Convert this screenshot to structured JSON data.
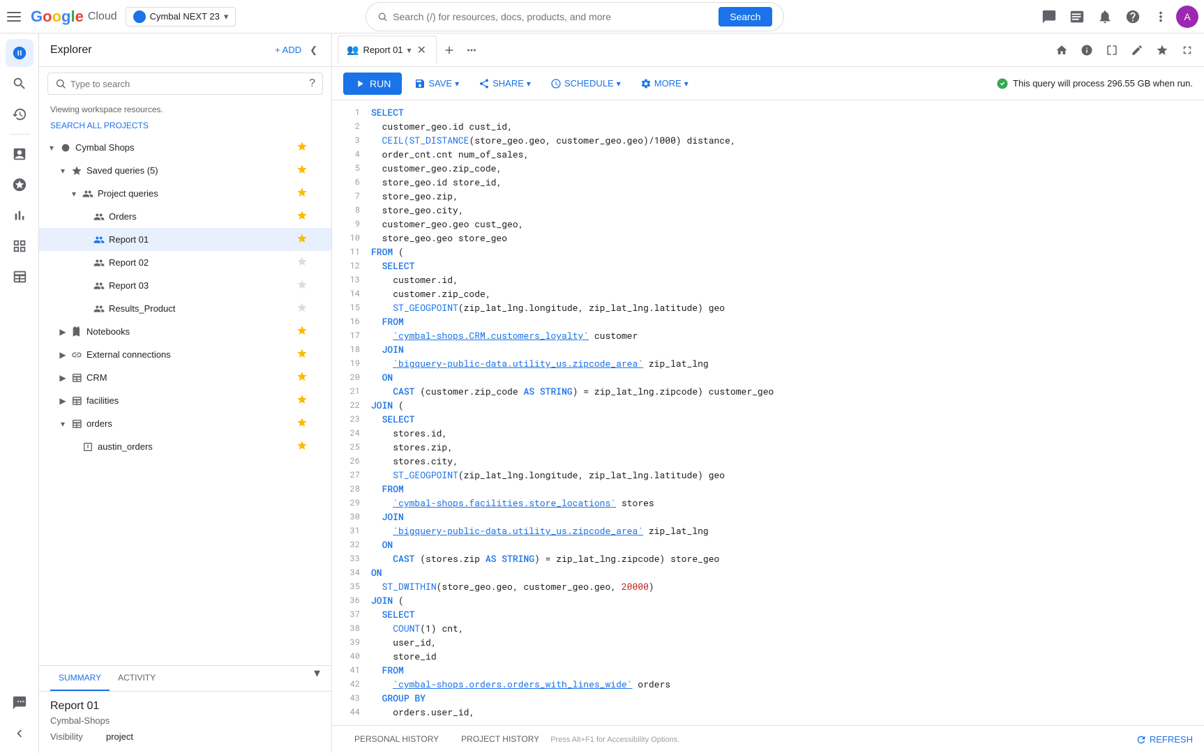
{
  "navbar": {
    "hamburger_label": "menu",
    "logo_text": "Google Cloud",
    "project_selector": {
      "icon": "●",
      "name": "Cymbal NEXT 23",
      "chevron": "▾"
    },
    "search": {
      "placeholder": "Search (/) for resources, docs, products, and more",
      "button_label": "Search"
    },
    "icons": [
      {
        "name": "support-chat-icon",
        "glyph": "💬"
      },
      {
        "name": "terminal-icon",
        "glyph": "⌨"
      },
      {
        "name": "notifications-icon",
        "glyph": "🔔"
      },
      {
        "name": "help-icon",
        "glyph": "?"
      },
      {
        "name": "more-icon",
        "glyph": "⋮"
      }
    ],
    "avatar": "A"
  },
  "explorer": {
    "title": "Explorer",
    "add_label": "+ ADD",
    "collapse_label": "❮",
    "search_placeholder": "Type to search",
    "workspace_info": "Viewing workspace resources.",
    "search_all_label": "SEARCH ALL PROJECTS",
    "tree": [
      {
        "id": "cymbal-shops",
        "level": 0,
        "toggle": "▾",
        "icon": "●",
        "icon_color": "#5f6368",
        "label": "Cymbal Shops",
        "starred": true,
        "has_more": true
      },
      {
        "id": "saved-queries",
        "level": 1,
        "toggle": "▾",
        "icon": "★",
        "icon_color": "#5f6368",
        "label": "Saved queries (5)",
        "starred": true,
        "has_more": true
      },
      {
        "id": "project-queries",
        "level": 2,
        "toggle": "▾",
        "icon": "👥",
        "icon_color": "#5f6368",
        "label": "Project queries",
        "starred": true,
        "has_more": true
      },
      {
        "id": "orders",
        "level": 3,
        "toggle": "",
        "icon": "👥",
        "icon_color": "#5f6368",
        "label": "Orders",
        "starred": true,
        "has_more": true
      },
      {
        "id": "report-01",
        "level": 3,
        "toggle": "",
        "icon": "👥",
        "icon_color": "#1a73e8",
        "label": "Report 01",
        "starred": true,
        "has_more": true,
        "selected": true
      },
      {
        "id": "report-02",
        "level": 3,
        "toggle": "",
        "icon": "👥",
        "icon_color": "#5f6368",
        "label": "Report 02",
        "starred": false,
        "has_more": true
      },
      {
        "id": "report-03",
        "level": 3,
        "toggle": "",
        "icon": "👥",
        "icon_color": "#5f6368",
        "label": "Report 03",
        "starred": false,
        "has_more": true
      },
      {
        "id": "results-product",
        "level": 3,
        "toggle": "",
        "icon": "👥",
        "icon_color": "#5f6368",
        "label": "Results_Product",
        "starred": false,
        "has_more": true
      },
      {
        "id": "notebooks",
        "level": 1,
        "toggle": "▶",
        "icon": "📓",
        "icon_color": "#5f6368",
        "label": "Notebooks",
        "starred": true,
        "has_more": true
      },
      {
        "id": "external-connections",
        "level": 1,
        "toggle": "▶",
        "icon": "🔗",
        "icon_color": "#5f6368",
        "label": "External connections",
        "starred": true,
        "has_more": true
      },
      {
        "id": "crm",
        "level": 1,
        "toggle": "▶",
        "icon": "⊞",
        "icon_color": "#5f6368",
        "label": "CRM",
        "starred": true,
        "has_more": true
      },
      {
        "id": "facilities",
        "level": 1,
        "toggle": "▶",
        "icon": "⊞",
        "icon_color": "#5f6368",
        "label": "facilities",
        "starred": true,
        "has_more": true
      },
      {
        "id": "orders-db",
        "level": 1,
        "toggle": "▾",
        "icon": "⊞",
        "icon_color": "#5f6368",
        "label": "orders",
        "starred": true,
        "has_more": true
      },
      {
        "id": "austin-orders",
        "level": 2,
        "toggle": "",
        "icon": "⊟",
        "icon_color": "#5f6368",
        "label": "austin_orders",
        "starred": true,
        "has_more": true
      }
    ]
  },
  "info_panel": {
    "tabs": [
      {
        "id": "summary",
        "label": "SUMMARY",
        "active": true
      },
      {
        "id": "activity",
        "label": "ACTIVITY",
        "active": false
      }
    ],
    "title": "Report 01",
    "subtitle": "Cymbal-Shops",
    "fields": [
      {
        "key": "Visibility",
        "value": "project"
      }
    ],
    "chevron": "▾"
  },
  "tabs": [
    {
      "id": "report-01",
      "icon": "👥",
      "label": "Report 01",
      "active": true,
      "closeable": true
    }
  ],
  "toolbar": {
    "run_label": "RUN",
    "run_icon": "▶",
    "save_label": "SAVE",
    "save_icon": "💾",
    "share_label": "SHARE",
    "share_icon": "🔗",
    "schedule_label": "SCHEDULE",
    "schedule_icon": "⏱",
    "more_label": "MORE",
    "more_icon": "⚙",
    "status_text": "This query will process 296.55 GB when run.",
    "status_icon": "✓"
  },
  "editor": {
    "lines": [
      {
        "num": 1,
        "tokens": [
          {
            "type": "kw",
            "text": "SELECT"
          }
        ]
      },
      {
        "num": 2,
        "tokens": [
          {
            "type": "plain",
            "text": "  customer_geo.id cust_id,"
          }
        ]
      },
      {
        "num": 3,
        "tokens": [
          {
            "type": "plain",
            "text": "  "
          },
          {
            "type": "fn",
            "text": "CEIL(ST_DISTANCE"
          },
          {
            "type": "plain",
            "text": "(store_geo.geo, customer_geo.geo)"
          },
          {
            "type": "plain",
            "text": "/1000) distance,"
          }
        ]
      },
      {
        "num": 4,
        "tokens": [
          {
            "type": "plain",
            "text": "  order_cnt.cnt num_of_sales,"
          }
        ]
      },
      {
        "num": 5,
        "tokens": [
          {
            "type": "plain",
            "text": "  customer_geo.zip_code,"
          }
        ]
      },
      {
        "num": 6,
        "tokens": [
          {
            "type": "plain",
            "text": "  store_geo.id store_id,"
          }
        ]
      },
      {
        "num": 7,
        "tokens": [
          {
            "type": "plain",
            "text": "  store_geo.zip,"
          }
        ]
      },
      {
        "num": 8,
        "tokens": [
          {
            "type": "plain",
            "text": "  store_geo.city,"
          }
        ]
      },
      {
        "num": 9,
        "tokens": [
          {
            "type": "plain",
            "text": "  customer_geo.geo cust_geo,"
          }
        ]
      },
      {
        "num": 10,
        "tokens": [
          {
            "type": "plain",
            "text": "  store_geo.geo store_geo"
          }
        ]
      },
      {
        "num": 11,
        "tokens": [
          {
            "type": "kw",
            "text": "FROM"
          },
          {
            "type": "plain",
            "text": " ("
          }
        ]
      },
      {
        "num": 12,
        "tokens": [
          {
            "type": "plain",
            "text": "  "
          },
          {
            "type": "kw",
            "text": "SELECT"
          }
        ]
      },
      {
        "num": 13,
        "tokens": [
          {
            "type": "plain",
            "text": "    customer.id,"
          }
        ]
      },
      {
        "num": 14,
        "tokens": [
          {
            "type": "plain",
            "text": "    customer.zip_code,"
          }
        ]
      },
      {
        "num": 15,
        "tokens": [
          {
            "type": "plain",
            "text": "    "
          },
          {
            "type": "fn",
            "text": "ST_GEOGPOINT"
          },
          {
            "type": "plain",
            "text": "(zip_lat_lng.longitude, zip_lat_lng.latitude) geo"
          }
        ]
      },
      {
        "num": 16,
        "tokens": [
          {
            "type": "plain",
            "text": "  "
          },
          {
            "type": "kw",
            "text": "FROM"
          }
        ]
      },
      {
        "num": 17,
        "tokens": [
          {
            "type": "plain",
            "text": "    "
          },
          {
            "type": "link",
            "text": "`cymbal-shops.CRM.customers_loyalty`"
          },
          {
            "type": "plain",
            "text": " customer"
          }
        ]
      },
      {
        "num": 18,
        "tokens": [
          {
            "type": "plain",
            "text": "  "
          },
          {
            "type": "kw",
            "text": "JOIN"
          }
        ]
      },
      {
        "num": 19,
        "tokens": [
          {
            "type": "plain",
            "text": "    "
          },
          {
            "type": "link",
            "text": "`bigquery-public-data.utility_us.zipcode_area`"
          },
          {
            "type": "plain",
            "text": " zip_lat_lng"
          }
        ]
      },
      {
        "num": 20,
        "tokens": [
          {
            "type": "plain",
            "text": "  "
          },
          {
            "type": "kw",
            "text": "ON"
          }
        ]
      },
      {
        "num": 21,
        "tokens": [
          {
            "type": "plain",
            "text": "    "
          },
          {
            "type": "kw",
            "text": "CAST"
          },
          {
            "type": "plain",
            "text": " (customer.zip_code "
          },
          {
            "type": "kw",
            "text": "AS STRING"
          },
          {
            "type": "plain",
            "text": ") = zip_lat_lng.zipcode) customer_geo"
          }
        ]
      },
      {
        "num": 22,
        "tokens": [
          {
            "type": "kw",
            "text": "JOIN"
          },
          {
            "type": "plain",
            "text": " ("
          }
        ]
      },
      {
        "num": 23,
        "tokens": [
          {
            "type": "plain",
            "text": "  "
          },
          {
            "type": "kw",
            "text": "SELECT"
          }
        ]
      },
      {
        "num": 24,
        "tokens": [
          {
            "type": "plain",
            "text": "    stores.id,"
          }
        ]
      },
      {
        "num": 25,
        "tokens": [
          {
            "type": "plain",
            "text": "    stores.zip,"
          }
        ]
      },
      {
        "num": 26,
        "tokens": [
          {
            "type": "plain",
            "text": "    stores.city,"
          }
        ]
      },
      {
        "num": 27,
        "tokens": [
          {
            "type": "plain",
            "text": "    "
          },
          {
            "type": "fn",
            "text": "ST_GEOGPOINT"
          },
          {
            "type": "plain",
            "text": "(zip_lat_lng.longitude, zip_lat_lng.latitude) geo"
          }
        ]
      },
      {
        "num": 28,
        "tokens": [
          {
            "type": "plain",
            "text": "  "
          },
          {
            "type": "kw",
            "text": "FROM"
          }
        ]
      },
      {
        "num": 29,
        "tokens": [
          {
            "type": "plain",
            "text": "    "
          },
          {
            "type": "link",
            "text": "`cymbal-shops.facilities.store_locations`"
          },
          {
            "type": "plain",
            "text": " stores"
          }
        ]
      },
      {
        "num": 30,
        "tokens": [
          {
            "type": "plain",
            "text": "  "
          },
          {
            "type": "kw",
            "text": "JOIN"
          }
        ]
      },
      {
        "num": 31,
        "tokens": [
          {
            "type": "plain",
            "text": "    "
          },
          {
            "type": "link",
            "text": "`bigquery-public-data.utility_us.zipcode_area`"
          },
          {
            "type": "plain",
            "text": " zip_lat_lng"
          }
        ]
      },
      {
        "num": 32,
        "tokens": [
          {
            "type": "plain",
            "text": "  "
          },
          {
            "type": "kw",
            "text": "ON"
          }
        ]
      },
      {
        "num": 33,
        "tokens": [
          {
            "type": "plain",
            "text": "    "
          },
          {
            "type": "kw",
            "text": "CAST"
          },
          {
            "type": "plain",
            "text": " (stores.zip "
          },
          {
            "type": "kw",
            "text": "AS STRING"
          },
          {
            "type": "plain",
            "text": ") = zip_lat_lng.zipcode) store_geo"
          }
        ]
      },
      {
        "num": 34,
        "tokens": [
          {
            "type": "kw",
            "text": "ON"
          }
        ]
      },
      {
        "num": 35,
        "tokens": [
          {
            "type": "plain",
            "text": "  "
          },
          {
            "type": "fn",
            "text": "ST_DWITHIN"
          },
          {
            "type": "plain",
            "text": "(store_geo.geo, customer_geo.geo, "
          },
          {
            "type": "num",
            "text": "20000"
          },
          {
            "type": "plain",
            "text": ")"
          }
        ]
      },
      {
        "num": 36,
        "tokens": [
          {
            "type": "kw",
            "text": "JOIN"
          },
          {
            "type": "plain",
            "text": " ("
          }
        ]
      },
      {
        "num": 37,
        "tokens": [
          {
            "type": "plain",
            "text": "  "
          },
          {
            "type": "kw",
            "text": "SELECT"
          }
        ]
      },
      {
        "num": 38,
        "tokens": [
          {
            "type": "plain",
            "text": "    "
          },
          {
            "type": "fn",
            "text": "COUNT"
          },
          {
            "type": "plain",
            "text": "(1) cnt,"
          }
        ]
      },
      {
        "num": 39,
        "tokens": [
          {
            "type": "plain",
            "text": "    user_id,"
          }
        ]
      },
      {
        "num": 40,
        "tokens": [
          {
            "type": "plain",
            "text": "    store_id"
          }
        ]
      },
      {
        "num": 41,
        "tokens": [
          {
            "type": "plain",
            "text": "  "
          },
          {
            "type": "kw",
            "text": "FROM"
          }
        ]
      },
      {
        "num": 42,
        "tokens": [
          {
            "type": "plain",
            "text": "    "
          },
          {
            "type": "link",
            "text": "`cymbal-shops.orders.orders_with_lines_wide`"
          },
          {
            "type": "plain",
            "text": " orders"
          }
        ]
      },
      {
        "num": 43,
        "tokens": [
          {
            "type": "plain",
            "text": "  "
          },
          {
            "type": "kw",
            "text": "GROUP BY"
          }
        ]
      },
      {
        "num": 44,
        "tokens": [
          {
            "type": "plain",
            "text": "    orders.user_id,"
          }
        ]
      }
    ]
  },
  "history": {
    "tabs": [
      {
        "id": "personal",
        "label": "PERSONAL HISTORY",
        "active": false
      },
      {
        "id": "project",
        "label": "PROJECT HISTORY",
        "active": false
      }
    ],
    "refresh_label": "REFRESH",
    "accessibility_hint": "Press Alt+F1 for Accessibility Options."
  },
  "rail_icons": [
    {
      "name": "bigquery-icon",
      "glyph": "◉",
      "active": true
    },
    {
      "name": "search-icon",
      "glyph": "🔍"
    },
    {
      "name": "history-icon",
      "glyph": "🕐"
    },
    {
      "name": "analytics-icon",
      "glyph": "📊"
    },
    {
      "name": "explore-icon",
      "glyph": "🔭"
    },
    {
      "name": "bar-chart-icon",
      "glyph": "📈"
    },
    {
      "name": "more-vert-icon",
      "glyph": "⋮"
    },
    {
      "name": "table-icon",
      "glyph": "⊞"
    },
    {
      "name": "feedback-icon",
      "glyph": "💬"
    },
    {
      "name": "collapse-icon",
      "glyph": "❮"
    }
  ]
}
